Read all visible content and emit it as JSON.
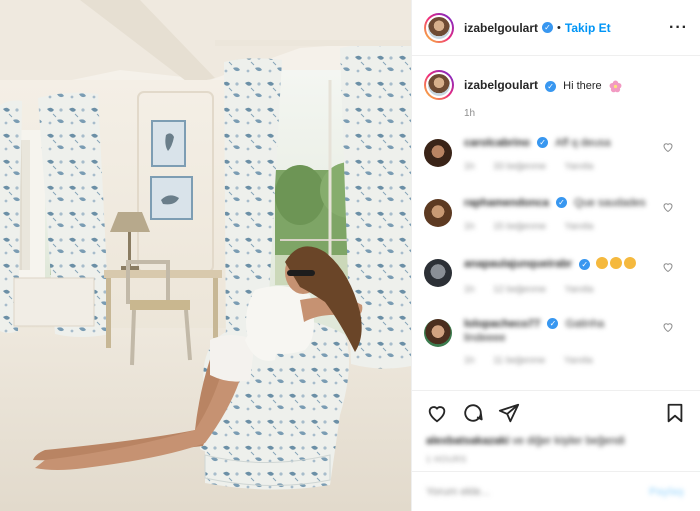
{
  "header": {
    "username": "izabelgoulart",
    "separator": "•",
    "follow_label": "Takip Et",
    "more_label": "···"
  },
  "caption": {
    "username": "izabelgoulart",
    "text": "Hi there",
    "time": "1h"
  },
  "comments": [
    {
      "username": "carolcabrino",
      "text": "Aff q deusa",
      "time": "1h",
      "likes": "33 beğenme",
      "reply": "Yanıtla"
    },
    {
      "username": "raphamendonca",
      "text": "Que saudades",
      "time": "1h",
      "likes": "15 beğenme",
      "reply": "Yanıtla"
    },
    {
      "username": "anapaulajunqueirabr",
      "text": "",
      "time": "1h",
      "likes": "12 beğenme",
      "reply": "Yanıtla"
    },
    {
      "username": "lolopacheco77",
      "text": "Gatinha lindeeee",
      "time": "1h",
      "likes": "11 beğenme",
      "reply": "Yanıtla"
    }
  ],
  "likes": {
    "user": "alexbatsakazaki",
    "rest": "ve diğer kişiler beğendi"
  },
  "date": "1 HOURS",
  "add_comment": {
    "placeholder": "Yorum ekle...",
    "share_label": "Paylaş"
  },
  "colors": {
    "link_blue": "#0095f6",
    "verified_blue": "#3897f0",
    "muted": "#8e8e8e",
    "share_disabled": "#b2dffc"
  },
  "icons": {
    "verified": "verified-badge-icon",
    "like": "heart-icon",
    "comment": "comment-icon",
    "share": "send-icon",
    "save": "bookmark-icon"
  }
}
